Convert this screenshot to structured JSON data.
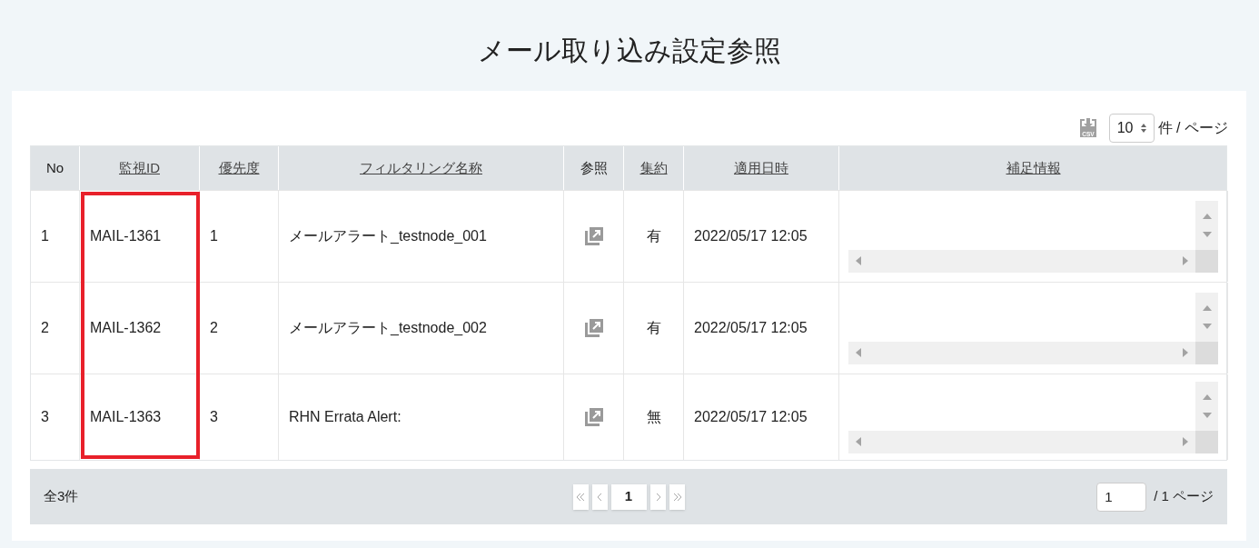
{
  "title": "メール取り込み設定参照",
  "toolbar": {
    "csv_label": "CSV",
    "page_size": "10",
    "page_size_unit": "件 / ページ"
  },
  "table": {
    "columns": [
      {
        "label": "No",
        "sortable": false,
        "highlighted": false
      },
      {
        "label": "監視ID",
        "sortable": true,
        "highlighted": true
      },
      {
        "label": "優先度",
        "sortable": true,
        "highlighted": false
      },
      {
        "label": "フィルタリング名称",
        "sortable": true,
        "highlighted": false
      },
      {
        "label": "参照",
        "sortable": false,
        "highlighted": false
      },
      {
        "label": "集約",
        "sortable": true,
        "highlighted": false
      },
      {
        "label": "適用日時",
        "sortable": true,
        "highlighted": false
      },
      {
        "label": "補足情報",
        "sortable": true,
        "highlighted": false
      }
    ],
    "rows": [
      {
        "no": "1",
        "monitor_id": "MAIL-1361",
        "priority": "1",
        "filter_name": "メールアラート_testnode_001",
        "aggregated": "有",
        "applied_at": "2022/05/17 12:05"
      },
      {
        "no": "2",
        "monitor_id": "MAIL-1362",
        "priority": "2",
        "filter_name": "メールアラート_testnode_002",
        "aggregated": "有",
        "applied_at": "2022/05/17 12:05"
      },
      {
        "no": "3",
        "monitor_id": "MAIL-1363",
        "priority": "3",
        "filter_name": "RHN Errata Alert:",
        "aggregated": "無",
        "applied_at": "2022/05/17 12:05"
      }
    ]
  },
  "footer": {
    "total": "全3件",
    "current_page": "1",
    "page_input": "1",
    "page_total": "/ 1 ページ"
  }
}
